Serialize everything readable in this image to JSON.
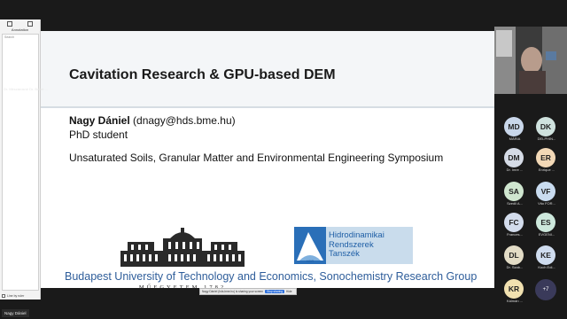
{
  "annotations": {
    "title": "Annotation",
    "search_placeholder": "Search",
    "footer_label": "Line by ruler"
  },
  "slide": {
    "title": "Cavitation Research & GPU-based DEM",
    "author_name": "Nagy Dániel",
    "author_email": " (dnagy@hds.bme.hu)",
    "role": "PhD student",
    "symposium": "Unsaturated Soils, Granular Matter and Environmental Engineering Symposium",
    "bme_caption": "MŰEGYETEM 1782",
    "hdr_lines": [
      "Hidrodinamikai",
      "Rendszerek",
      "Tanszék"
    ],
    "hdr_mark_text": "HDR",
    "footer": "Budapest University of Technology and Economics, Sonochemistry Research Group"
  },
  "share_banner": {
    "text": "Nagy Dániel (hds.bme.hu) is sharing your screen",
    "stop": "Stop sharing",
    "hide": "Hide"
  },
  "self_name": "Nagy Dániel",
  "video": {
    "caption": "Dr. Mészárosné Dr. Bálint ..."
  },
  "participants": [
    {
      "initials": "MD",
      "name": "MÁRIA",
      "color": "#c9d7ea"
    },
    {
      "initials": "DK",
      "name": "DELPHIN...",
      "color": "#cfe2de"
    },
    {
      "initials": "DM",
      "name": "Dr. Imre ...",
      "color": "#d5dbe6"
    },
    {
      "initials": "ER",
      "name": "Enrique ...",
      "color": "#f2d8b6"
    },
    {
      "initials": "SA",
      "name": "Szedli A...",
      "color": "#cfe6cf"
    },
    {
      "initials": "VF",
      "name": "Vito FOR...",
      "color": "#c9dcf0"
    },
    {
      "initials": "FC",
      "name": "Frances...",
      "color": "#d3dcec"
    },
    {
      "initials": "ES",
      "name": "EVGENI...",
      "color": "#cde8dc"
    },
    {
      "initials": "DL",
      "name": "Dr. Szab...",
      "color": "#e3dcc6"
    },
    {
      "initials": "KE",
      "name": "Koch Edi...",
      "color": "#cfdcef"
    },
    {
      "initials": "KR",
      "name": "Kálmán ...",
      "color": "#f1e1b0"
    }
  ],
  "more_count": "+7"
}
